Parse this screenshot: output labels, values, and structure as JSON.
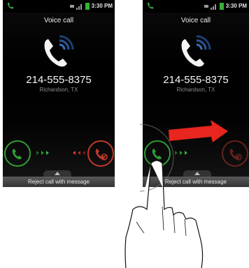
{
  "panels": [
    {
      "status": {
        "time": "3:30 PM"
      },
      "title": "Voice call",
      "number": "214-555-8375",
      "location": "Richardson, TX",
      "reject_message_label": "Reject call with message"
    },
    {
      "status": {
        "time": "3:30 PM"
      },
      "title": "Voice call",
      "number": "214-555-8375",
      "location": "Richardson, TX",
      "reject_message_label": "Reject call with message"
    }
  ],
  "icons": {
    "answer": "phone-answer-icon",
    "reject": "phone-reject-icon",
    "incoming_call": "incoming-call-icon",
    "drag_arrow": "red-arrow-icon",
    "hand": "hand-gesture-icon"
  },
  "colors": {
    "answer": "#2f9e34",
    "reject": "#c0392b",
    "arrow": "#e8251e",
    "wave": "#2f5d9a"
  }
}
